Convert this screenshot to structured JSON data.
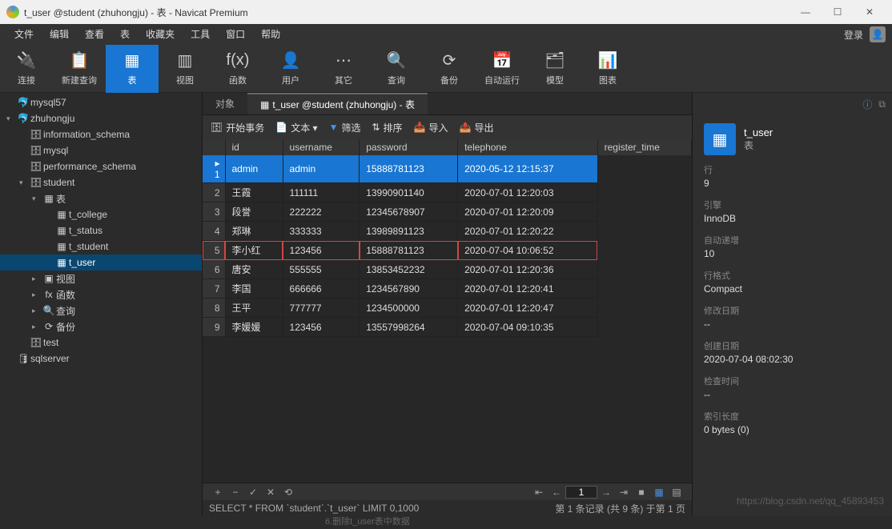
{
  "window": {
    "title": "t_user @student (zhuhongju) - 表 - Navicat Premium",
    "login": "登录"
  },
  "menu": [
    "文件",
    "编辑",
    "查看",
    "表",
    "收藏夹",
    "工具",
    "窗口",
    "帮助"
  ],
  "toolbar": [
    {
      "icon": "🔌",
      "label": "连接"
    },
    {
      "icon": "📋",
      "label": "新建查询"
    },
    {
      "icon": "▦",
      "label": "表",
      "active": true
    },
    {
      "icon": "▥",
      "label": "视图"
    },
    {
      "icon": "f(x)",
      "label": "函数"
    },
    {
      "icon": "👤",
      "label": "用户"
    },
    {
      "icon": "⋯",
      "label": "其它"
    },
    {
      "icon": "🔍",
      "label": "查询"
    },
    {
      "icon": "⟳",
      "label": "备份"
    },
    {
      "icon": "📅",
      "label": "自动运行"
    },
    {
      "icon": "🗂",
      "label": "模型"
    },
    {
      "icon": "📊",
      "label": "图表"
    }
  ],
  "tree": [
    {
      "d": 0,
      "a": "",
      "i": "🐬",
      "t": "mysql57"
    },
    {
      "d": 0,
      "a": "▾",
      "i": "🐬",
      "t": "zhuhongju"
    },
    {
      "d": 1,
      "a": "",
      "i": "🗄",
      "t": "information_schema"
    },
    {
      "d": 1,
      "a": "",
      "i": "🗄",
      "t": "mysql"
    },
    {
      "d": 1,
      "a": "",
      "i": "🗄",
      "t": "performance_schema"
    },
    {
      "d": 1,
      "a": "▾",
      "i": "🗄",
      "t": "student"
    },
    {
      "d": 2,
      "a": "▾",
      "i": "▦",
      "t": "表"
    },
    {
      "d": 3,
      "a": "",
      "i": "▦",
      "t": "t_college"
    },
    {
      "d": 3,
      "a": "",
      "i": "▦",
      "t": "t_status"
    },
    {
      "d": 3,
      "a": "",
      "i": "▦",
      "t": "t_student"
    },
    {
      "d": 3,
      "a": "",
      "i": "▦",
      "t": "t_user",
      "sel": true
    },
    {
      "d": 2,
      "a": "▸",
      "i": "▣",
      "t": "视图"
    },
    {
      "d": 2,
      "a": "▸",
      "i": "fx",
      "t": "函数"
    },
    {
      "d": 2,
      "a": "▸",
      "i": "🔍",
      "t": "查询"
    },
    {
      "d": 2,
      "a": "▸",
      "i": "⟳",
      "t": "备份"
    },
    {
      "d": 1,
      "a": "",
      "i": "🗄",
      "t": "test"
    },
    {
      "d": 0,
      "a": "",
      "i": "🛢",
      "t": "sqlserver"
    }
  ],
  "tabs": {
    "obj": "对象",
    "active": "t_user @student (zhuhongju) - 表"
  },
  "subtool": {
    "begin": "开始事务",
    "text": "文本 ▾",
    "filter": "筛选",
    "sort": "排序",
    "import": "导入",
    "export": "导出"
  },
  "table": {
    "cols": [
      "id",
      "username",
      "password",
      "telephone",
      "register_time"
    ],
    "rows": [
      {
        "n": 1,
        "c": [
          "admin",
          "admin",
          "15888781123",
          "2020-05-12 12:15:37"
        ],
        "sel": true
      },
      {
        "n": 2,
        "c": [
          "王霞",
          "111111",
          "13990901140",
          "2020-07-01 12:20:03"
        ]
      },
      {
        "n": 3,
        "c": [
          "段誉",
          "222222",
          "12345678907",
          "2020-07-01 12:20:09"
        ]
      },
      {
        "n": 4,
        "c": [
          "郑琳",
          "333333",
          "13989891123",
          "2020-07-01 12:20:22"
        ]
      },
      {
        "n": 5,
        "c": [
          "李小红",
          "123456",
          "15888781123",
          "2020-07-04 10:06:52"
        ],
        "hl": true
      },
      {
        "n": 6,
        "c": [
          "唐安",
          "555555",
          "13853452232",
          "2020-07-01 12:20:36"
        ]
      },
      {
        "n": 7,
        "c": [
          "李国",
          "666666",
          "1234567890",
          "2020-07-01 12:20:41"
        ]
      },
      {
        "n": 8,
        "c": [
          "王平",
          "777777",
          "1234500000",
          "2020-07-01 12:20:47"
        ]
      },
      {
        "n": 9,
        "c": [
          "李媛媛",
          "123456",
          "13557998264",
          "2020-07-04 09:10:35"
        ]
      }
    ]
  },
  "paginator": {
    "page": "1"
  },
  "status": {
    "sql": "SELECT * FROM `student`.`t_user` LIMIT 0,1000",
    "right": "第 1 条记录 (共 9 条) 于第 1 页"
  },
  "props": {
    "title": "t_user",
    "sub": "表",
    "items": [
      {
        "l": "行",
        "v": "9"
      },
      {
        "l": "引擎",
        "v": "InnoDB"
      },
      {
        "l": "自动递增",
        "v": "10"
      },
      {
        "l": "行格式",
        "v": "Compact"
      },
      {
        "l": "修改日期",
        "v": "--"
      },
      {
        "l": "创建日期",
        "v": "2020-07-04 08:02:30"
      },
      {
        "l": "检查时间",
        "v": "--"
      },
      {
        "l": "索引长度",
        "v": "0 bytes (0)"
      }
    ]
  },
  "watermark": "https://blog.csdn.net/qq_45893453",
  "extra": "6.删除t_user表中数据"
}
